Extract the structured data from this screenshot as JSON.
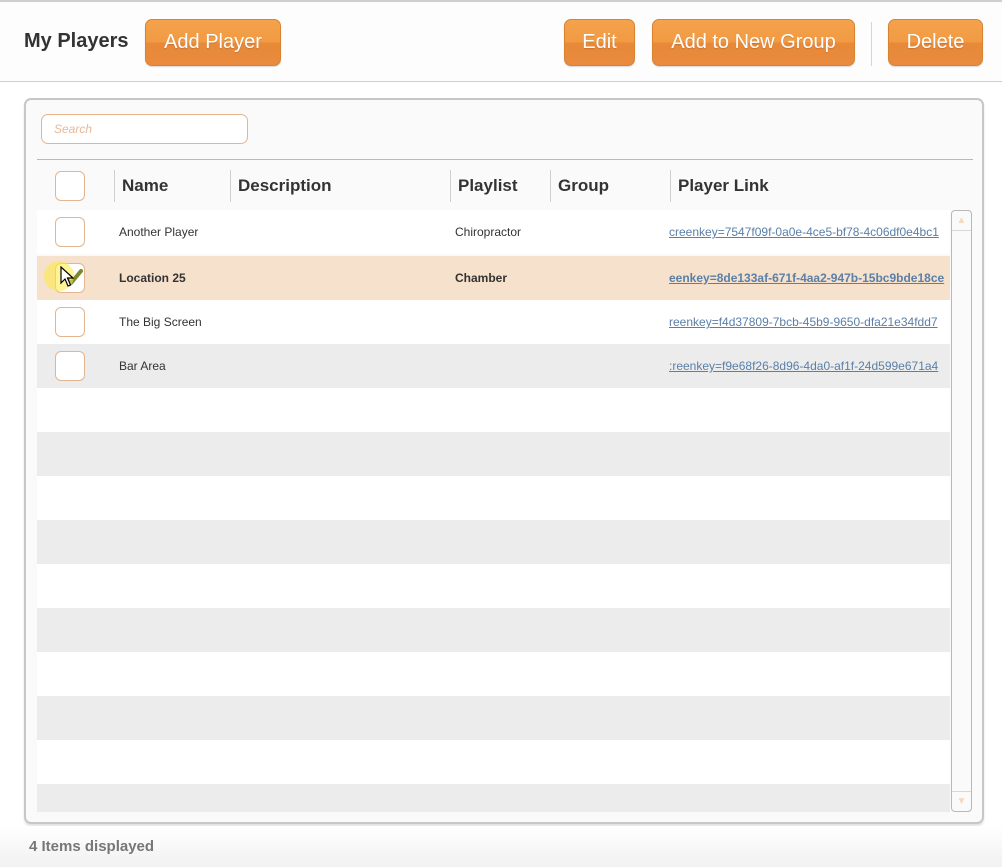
{
  "header": {
    "title": "My Players",
    "buttons": {
      "add_player": "Add Player",
      "edit": "Edit",
      "add_to_new_group": "Add to New Group",
      "delete": "Delete"
    }
  },
  "search": {
    "placeholder": "Search",
    "value": ""
  },
  "table": {
    "columns": [
      "Name",
      "Description",
      "Playlist",
      "Group",
      "Player Link"
    ],
    "rows": [
      {
        "name": "Another Player",
        "description": "",
        "playlist": "Chiropractor",
        "group": "",
        "link": "creenkey=7547f09f-0a0e-4ce5-bf78-4c06df0e4bc1",
        "checked": false,
        "selected": false
      },
      {
        "name": "Location 25",
        "description": "",
        "playlist": "Chamber",
        "group": "",
        "link": "eenkey=8de133af-671f-4aa2-947b-15bc9bde18ce",
        "checked": true,
        "selected": true
      },
      {
        "name": "The Big Screen",
        "description": "",
        "playlist": "",
        "group": "",
        "link": "reenkey=f4d37809-7bcb-45b9-9650-dfa21e34fdd7",
        "checked": false,
        "selected": false
      },
      {
        "name": "Bar Area",
        "description": "",
        "playlist": "",
        "group": "",
        "link": ":reenkey=f9e68f26-8d96-4da0-af1f-24d599e671a4",
        "checked": false,
        "selected": false
      }
    ]
  },
  "footer": {
    "status": "4 Items displayed"
  },
  "colors": {
    "accent": "#f19b43",
    "selected_row": "#f5e1cc",
    "link": "#5a7fa8",
    "alt_row": "#ececec"
  }
}
